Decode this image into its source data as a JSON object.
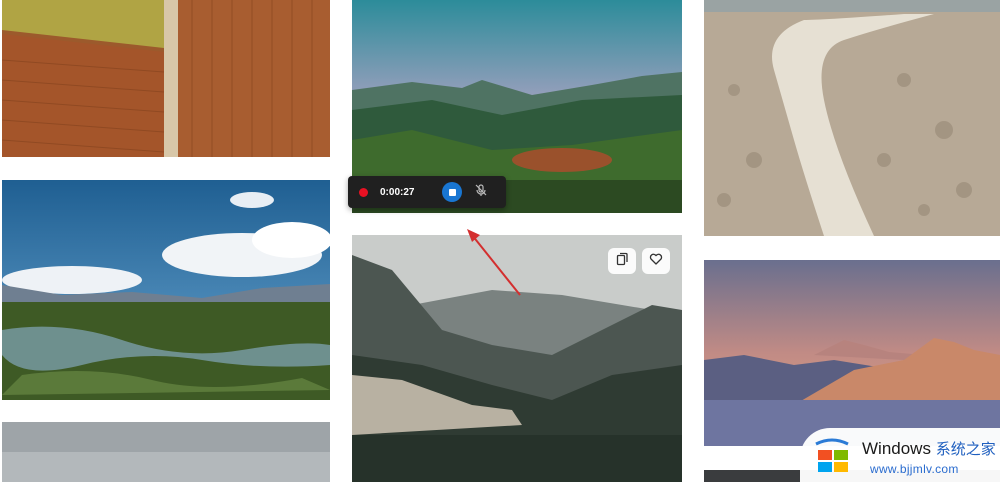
{
  "recorder": {
    "elapsed": "0:00:27"
  },
  "gallery": {
    "images": [
      {
        "subject": "aerial farm fields"
      },
      {
        "subject": "green mountain valley"
      },
      {
        "subject": "salt flat trail"
      },
      {
        "subject": "wetland under blue sky"
      },
      {
        "subject": "forested mountains"
      },
      {
        "subject": "mountains at dusk over clouds"
      },
      {
        "subject": "grey sky"
      }
    ],
    "overlay_icons": [
      "collection-icon",
      "heart-icon"
    ]
  },
  "watermark": {
    "brand": "Windows",
    "brand_cn": "系统之家",
    "url": "www.bjjmlv.com"
  },
  "colors": {
    "record": "#e81123",
    "stop": "#1976d2",
    "annotation_arrow": "#d32f2f",
    "watermark_blue": "#2a6ccf"
  }
}
